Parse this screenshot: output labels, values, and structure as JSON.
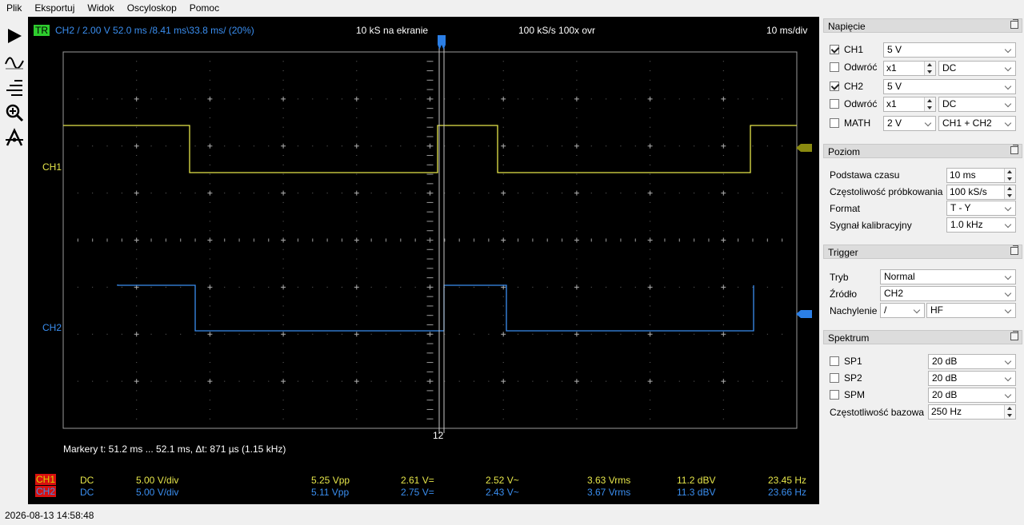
{
  "menu": [
    "Plik",
    "Eksportuj",
    "Widok",
    "Oscyloskop",
    "Pomoc"
  ],
  "toolbar": [
    "play-icon",
    "waveform-icon",
    "trigger-level-icon",
    "zoom-icon",
    "measure-icon"
  ],
  "scope": {
    "trigger_badge": "TR",
    "trigger_info": "CH2  /  2.00 V  52.0 ms /8.41 ms\\33.8 ms/ (20%)",
    "samples": "10 kS na ekranie",
    "rate": "100 kS/s 100x ovr",
    "timebase": "10 ms/div",
    "ch1_label": "CH1",
    "ch2_label": "CH2",
    "cursor_label": "12",
    "markers": "Markery    t: 51.2 ms ... 52.1 ms,   Δt: 871 µs (1.15 kHz)",
    "colors": {
      "ch1": "#e6e64a",
      "ch2": "#3a8ef0",
      "trigger": "#5cd05c"
    },
    "measurements": [
      {
        "ch": "CH1",
        "coupling": "DC",
        "vdiv": "5.00 V/div",
        "vpp": "5.25 Vpp",
        "vdc": "2.61 V=",
        "vac": "2.52 V~",
        "vrms": "3.63 Vrms",
        "dbv": "11.2 dBV",
        "freq": "23.45 Hz"
      },
      {
        "ch": "CH2",
        "coupling": "DC",
        "vdiv": "5.00 V/div",
        "vpp": "5.11 Vpp",
        "vdc": "2.75 V=",
        "vac": "2.43 V~",
        "vrms": "3.67 Vrms",
        "dbv": "11.3 dBV",
        "freq": "23.66 Hz"
      }
    ]
  },
  "status_time": "2026-08-13 14:58:48",
  "panel": {
    "napiecie": {
      "title": "Napięcie",
      "ch1": {
        "label": "CH1",
        "checked": true,
        "value": "5 V"
      },
      "odwroc1": {
        "label": "Odwróć",
        "checked": false,
        "mult": "x1",
        "coupling": "DC"
      },
      "ch2": {
        "label": "CH2",
        "checked": true,
        "value": "5 V"
      },
      "odwroc2": {
        "label": "Odwróć",
        "checked": false,
        "mult": "x1",
        "coupling": "DC"
      },
      "math": {
        "label": "MATH",
        "checked": false,
        "value": "2 V",
        "func": "CH1 + CH2"
      }
    },
    "poziom": {
      "title": "Poziom",
      "podstawa_label": "Podstawa czasu",
      "podstawa": "10 ms",
      "probkowanie_label": "Częstoliwość próbkowania",
      "probkowanie": "100 kS/s",
      "format_label": "Format",
      "format": "T - Y",
      "kalib_label": "Sygnał kalibracyjny",
      "kalib": "1.0 kHz"
    },
    "trigger": {
      "title": "Trigger",
      "tryb_label": "Tryb",
      "tryb": "Normal",
      "zrodlo_label": "Źródło",
      "zrodlo": "CH2",
      "nachylenie_label": "Nachylenie",
      "nachylenie": "/",
      "filter": "HF"
    },
    "spektrum": {
      "title": "Spektrum",
      "sp1": {
        "label": "SP1",
        "checked": false,
        "value": "20 dB"
      },
      "sp2": {
        "label": "SP2",
        "checked": false,
        "value": "20 dB"
      },
      "spm": {
        "label": "SPM",
        "checked": false,
        "value": "20 dB"
      },
      "baza_label": "Częstotliwość bazowa",
      "baza": "250 Hz"
    }
  }
}
